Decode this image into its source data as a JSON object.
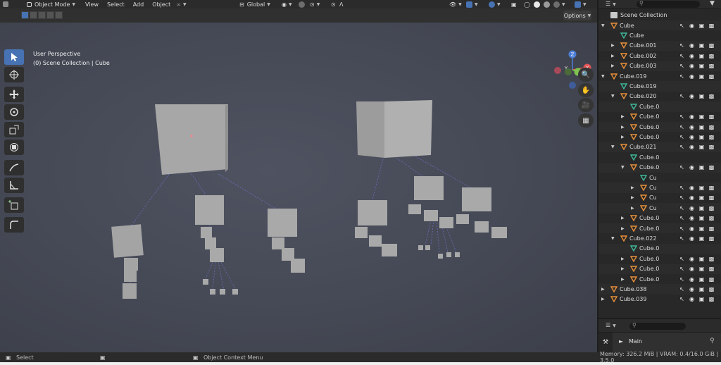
{
  "header": {
    "mode": "Object Mode",
    "menus": [
      "View",
      "Select",
      "Add",
      "Object"
    ],
    "transform_orientation": "Global",
    "options_label": "Options"
  },
  "viewport": {
    "perspective": "User Perspective",
    "collection_info": "(0) Scene Collection | Cube",
    "gizmo_axes": {
      "x": "X",
      "y": "Y",
      "z": "Z"
    },
    "background": "#474b57",
    "cube_color": "#a6a6a6"
  },
  "left_tools": [
    "select-box",
    "cursor",
    "move",
    "rotate",
    "scale",
    "transform",
    "annotate",
    "measure",
    "add-cube",
    "bevel"
  ],
  "nav_icons": [
    "zoom-icon",
    "pan-hand-icon",
    "camera-icon",
    "grid-view-icon"
  ],
  "outliner": {
    "root": "Scene Collection",
    "rows": [
      {
        "label": "Cube",
        "depth": 0,
        "kind": "mesh",
        "expanded": true
      },
      {
        "label": "Cube",
        "depth": 1,
        "kind": "data"
      },
      {
        "label": "Cube.001",
        "depth": 1,
        "kind": "mesh"
      },
      {
        "label": "Cube.002",
        "depth": 1,
        "kind": "mesh"
      },
      {
        "label": "Cube.003",
        "depth": 1,
        "kind": "mesh"
      },
      {
        "label": "Cube.019",
        "depth": 0,
        "kind": "mesh",
        "expanded": true
      },
      {
        "label": "Cube.019",
        "depth": 1,
        "kind": "data"
      },
      {
        "label": "Cube.020",
        "depth": 1,
        "kind": "mesh",
        "expanded": true
      },
      {
        "label": "Cube.0",
        "depth": 2,
        "kind": "data"
      },
      {
        "label": "Cube.0",
        "depth": 2,
        "kind": "mesh"
      },
      {
        "label": "Cube.0",
        "depth": 2,
        "kind": "mesh"
      },
      {
        "label": "Cube.0",
        "depth": 2,
        "kind": "mesh"
      },
      {
        "label": "Cube.021",
        "depth": 1,
        "kind": "mesh",
        "expanded": true
      },
      {
        "label": "Cube.0",
        "depth": 2,
        "kind": "data"
      },
      {
        "label": "Cube.0",
        "depth": 2,
        "kind": "mesh",
        "expanded": true
      },
      {
        "label": "Cu",
        "depth": 3,
        "kind": "data"
      },
      {
        "label": "Cu",
        "depth": 3,
        "kind": "mesh"
      },
      {
        "label": "Cu",
        "depth": 3,
        "kind": "mesh"
      },
      {
        "label": "Cu",
        "depth": 3,
        "kind": "mesh"
      },
      {
        "label": "Cube.0",
        "depth": 2,
        "kind": "mesh"
      },
      {
        "label": "Cube.0",
        "depth": 2,
        "kind": "mesh"
      },
      {
        "label": "Cube.022",
        "depth": 1,
        "kind": "mesh",
        "expanded": true
      },
      {
        "label": "Cube.0",
        "depth": 2,
        "kind": "data"
      },
      {
        "label": "Cube.0",
        "depth": 2,
        "kind": "mesh"
      },
      {
        "label": "Cube.0",
        "depth": 2,
        "kind": "mesh"
      },
      {
        "label": "Cube.0",
        "depth": 2,
        "kind": "mesh"
      },
      {
        "label": "Cube.038",
        "depth": 0,
        "kind": "mesh"
      },
      {
        "label": "Cube.039",
        "depth": 0,
        "kind": "mesh"
      }
    ]
  },
  "properties": {
    "main_label": "Main"
  },
  "statusbar": {
    "left": "Select",
    "middle": "Object Context Menu",
    "right": "Memory: 326.2 MiB | VRAM: 0.4/16.0 GiB | 3.5.0"
  }
}
